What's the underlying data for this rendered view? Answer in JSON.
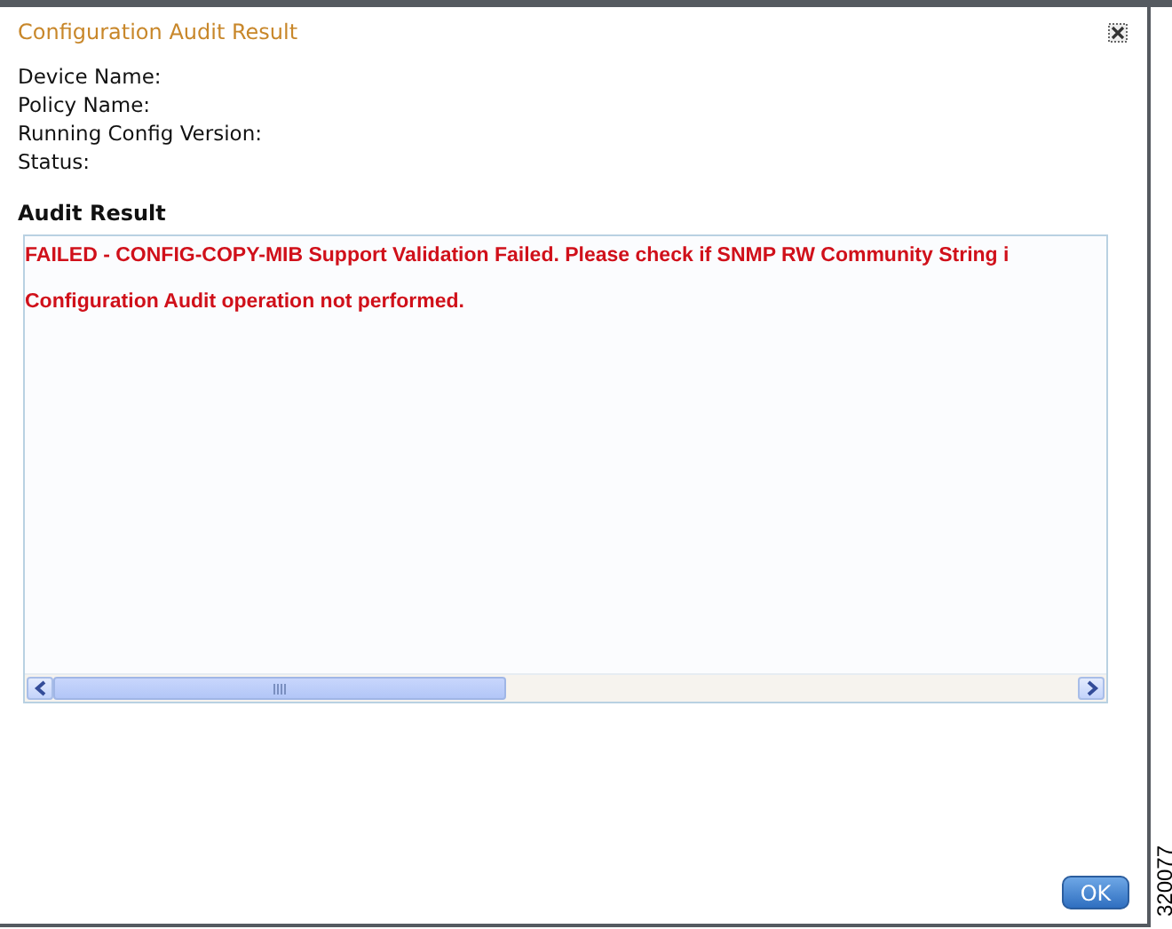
{
  "dialog": {
    "title": "Configuration Audit Result",
    "fields": [
      {
        "label": "Device Name:"
      },
      {
        "label": "Policy Name:"
      },
      {
        "label": "Running Config Version:"
      },
      {
        "label": "Status:"
      }
    ],
    "section_title": "Audit Result",
    "result_lines": [
      "FAILED - CONFIG-COPY-MIB Support Validation Failed. Please check if SNMP RW Community String i",
      "Configuration Audit operation not performed."
    ],
    "buttons": [
      "OK"
    ]
  },
  "figure_number": "320077"
}
